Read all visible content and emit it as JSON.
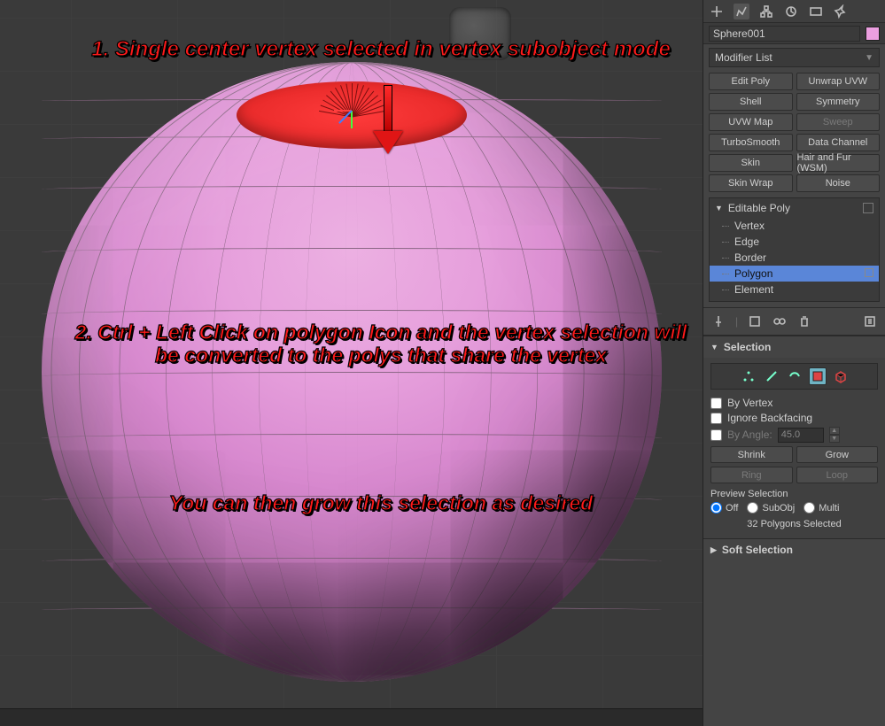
{
  "viewport": {
    "annotation1": "1. Single center vertex selected in vertex subobject mode",
    "annotation2": "2. Ctrl + Left Click on polygon Icon and the vertex selection will be converted to the polys that share the vertex",
    "annotation3": "You can then grow this selection as desired"
  },
  "panel": {
    "object_name": "Sphere001",
    "modifier_list_label": "Modifier List",
    "modifier_buttons": [
      [
        "Edit Poly",
        "Unwrap UVW"
      ],
      [
        "Shell",
        "Symmetry"
      ],
      [
        "UVW Map",
        "Sweep"
      ],
      [
        "TurboSmooth",
        "Data Channel"
      ],
      [
        "Skin",
        "Hair and Fur (WSM)"
      ],
      [
        "Skin Wrap",
        "Noise"
      ]
    ],
    "modifier_disabled": [
      "Sweep"
    ],
    "stack_root": "Editable Poly",
    "stack_subs": [
      "Vertex",
      "Edge",
      "Border",
      "Polygon",
      "Element"
    ],
    "stack_selected": "Polygon",
    "rollup_selection": "Selection",
    "by_vertex": "By Vertex",
    "ignore_backfacing": "Ignore Backfacing",
    "by_angle": "By Angle:",
    "by_angle_value": "45.0",
    "shrink": "Shrink",
    "grow": "Grow",
    "ring": "Ring",
    "loop": "Loop",
    "preview_label": "Preview Selection",
    "preview_off": "Off",
    "preview_subobj": "SubObj",
    "preview_multi": "Multi",
    "status": "32 Polygons Selected",
    "rollup_soft": "Soft Selection"
  },
  "icons": {
    "vertex": "vertex-icon",
    "edge": "edge-icon",
    "border": "border-icon",
    "polygon": "polygon-icon",
    "element": "element-icon"
  }
}
